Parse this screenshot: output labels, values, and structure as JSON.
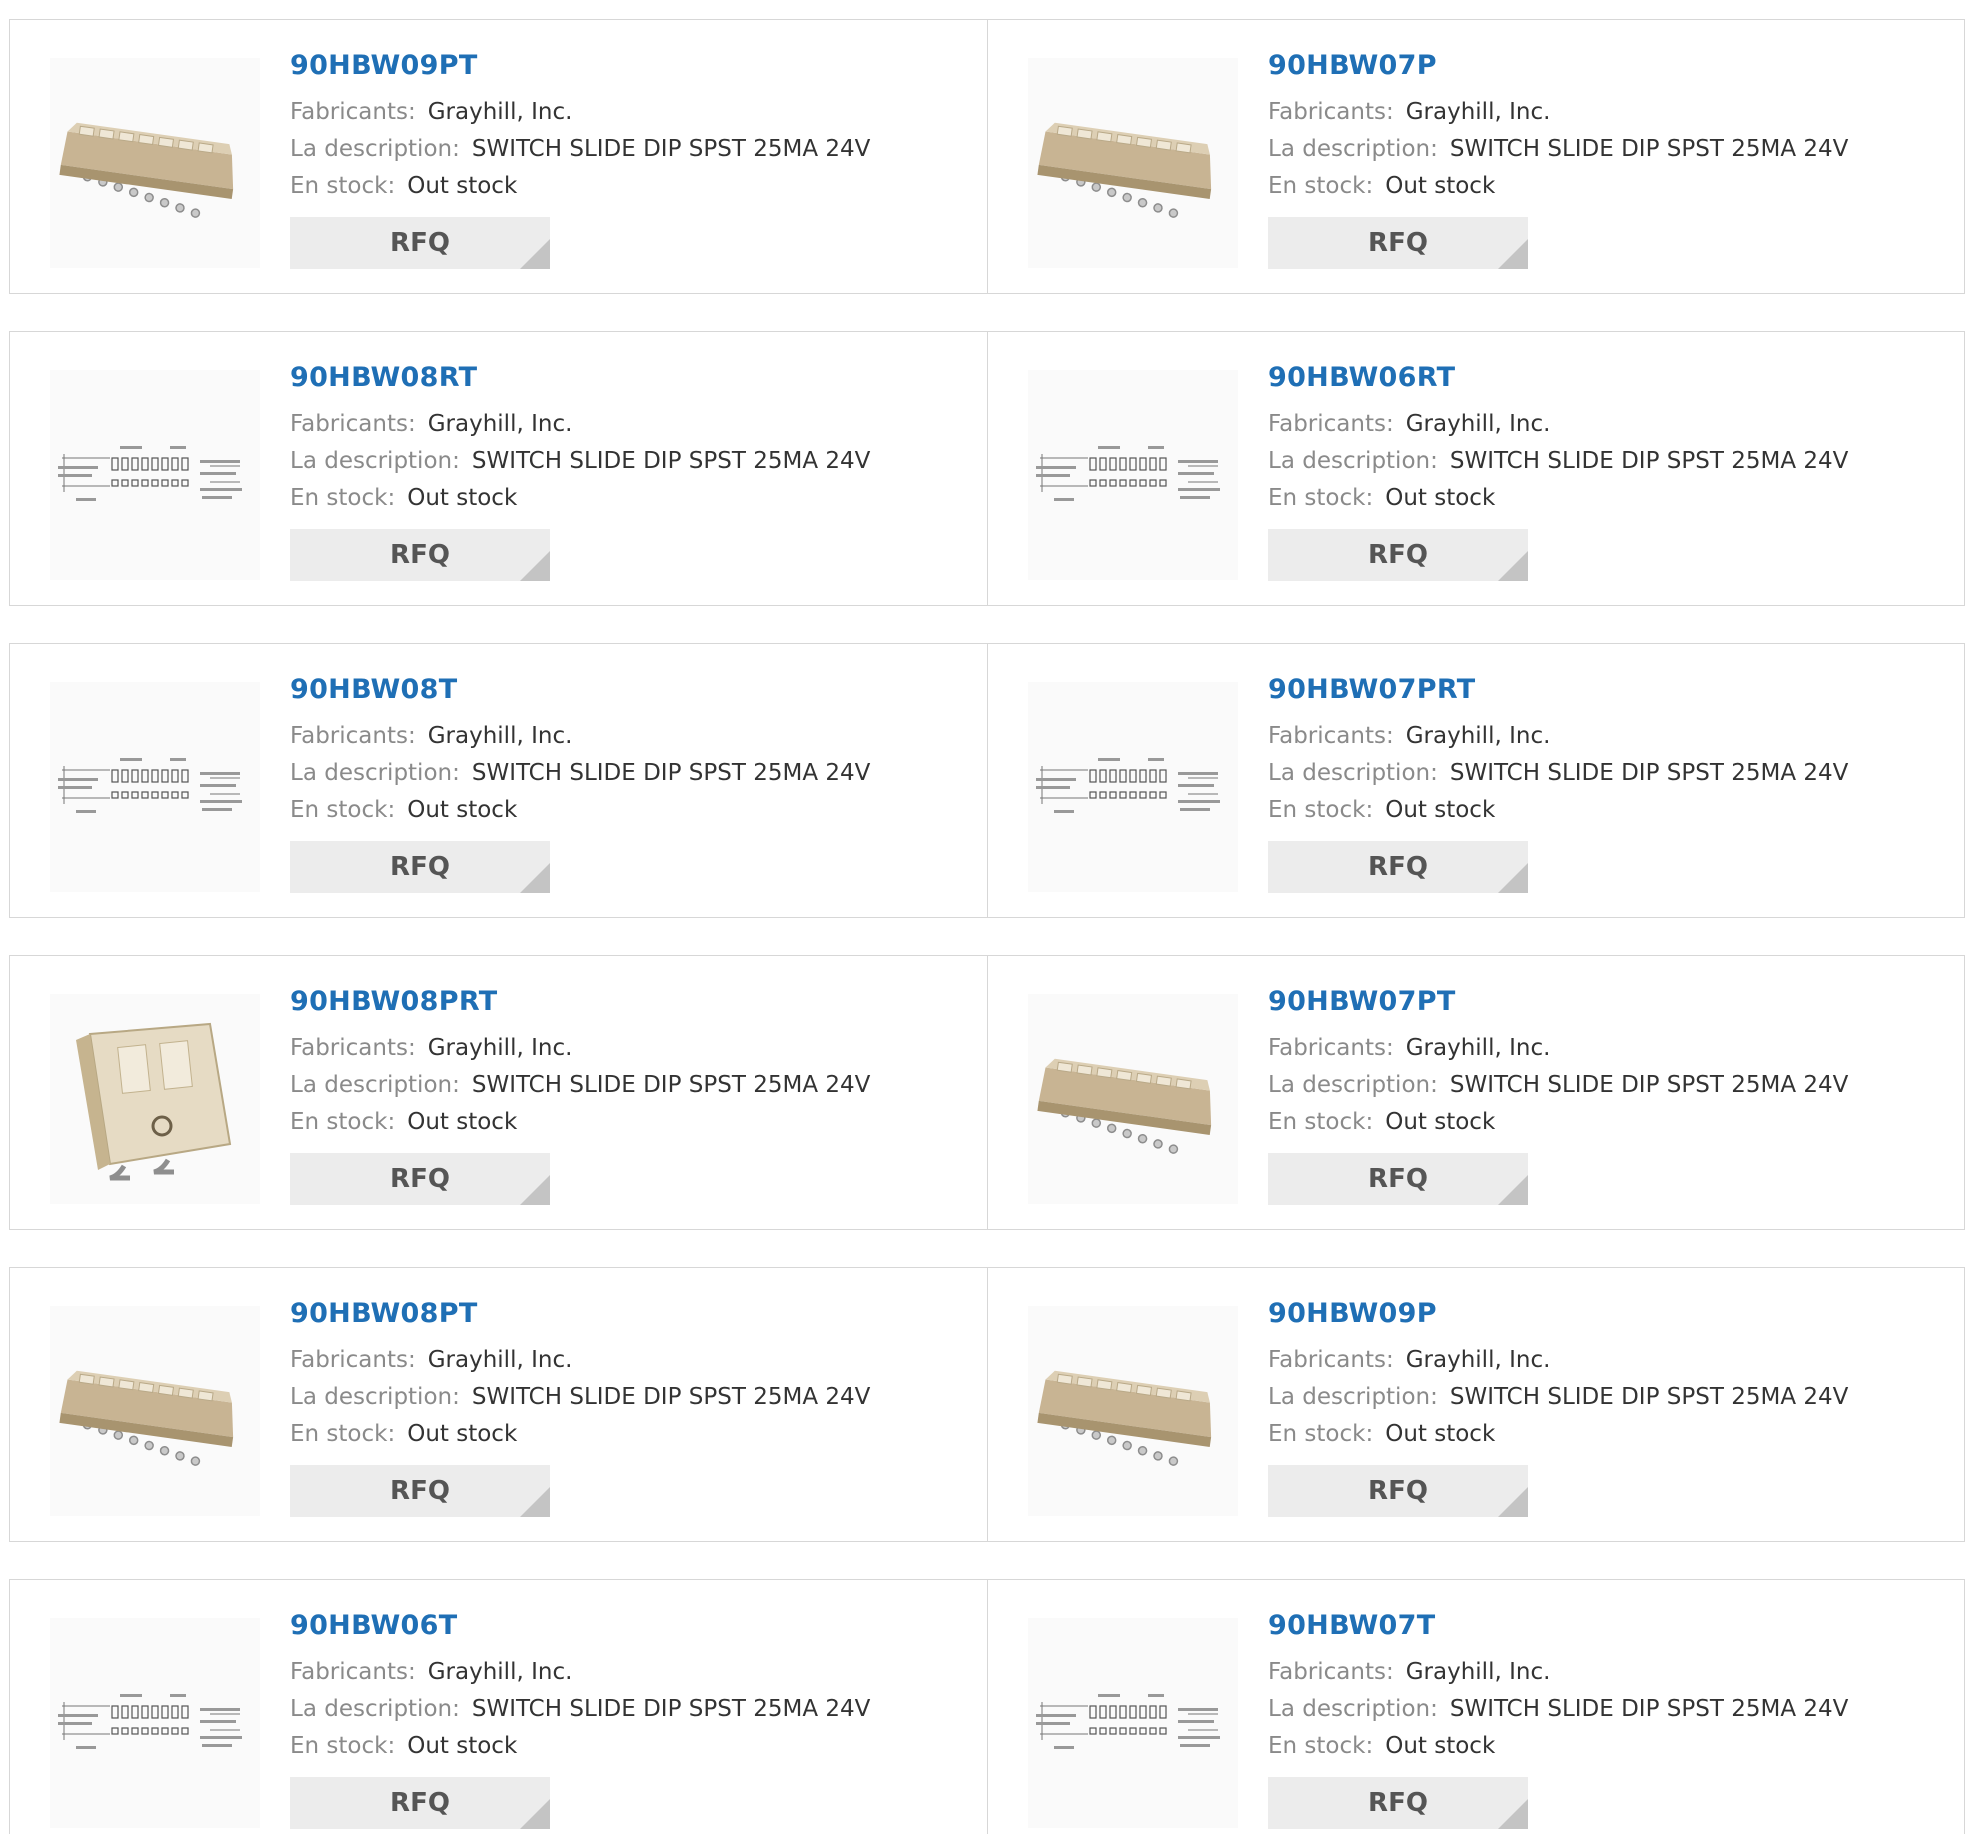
{
  "labels": {
    "manufacturer": "Fabricants:",
    "description": "La description:",
    "stock": "En stock:"
  },
  "button": {
    "rfq": "RFQ"
  },
  "rows": [
    [
      {
        "part": "90HBW09PT",
        "manufacturer": "Grayhill, Inc.",
        "description": "SWITCH SLIDE DIP SPST 25MA 24V",
        "stock": "Out stock",
        "image": "dip-switch-photo"
      },
      {
        "part": "90HBW07P",
        "manufacturer": "Grayhill, Inc.",
        "description": "SWITCH SLIDE DIP SPST 25MA 24V",
        "stock": "Out stock",
        "image": "dip-switch-photo"
      }
    ],
    [
      {
        "part": "90HBW08RT",
        "manufacturer": "Grayhill, Inc.",
        "description": "SWITCH SLIDE DIP SPST 25MA 24V",
        "stock": "Out stock",
        "image": "dimension-drawing"
      },
      {
        "part": "90HBW06RT",
        "manufacturer": "Grayhill, Inc.",
        "description": "SWITCH SLIDE DIP SPST 25MA 24V",
        "stock": "Out stock",
        "image": "dimension-drawing"
      }
    ],
    [
      {
        "part": "90HBW08T",
        "manufacturer": "Grayhill, Inc.",
        "description": "SWITCH SLIDE DIP SPST 25MA 24V",
        "stock": "Out stock",
        "image": "dimension-drawing"
      },
      {
        "part": "90HBW07PRT",
        "manufacturer": "Grayhill, Inc.",
        "description": "SWITCH SLIDE DIP SPST 25MA 24V",
        "stock": "Out stock",
        "image": "dimension-drawing"
      }
    ],
    [
      {
        "part": "90HBW08PRT",
        "manufacturer": "Grayhill, Inc.",
        "description": "SWITCH SLIDE DIP SPST 25MA 24V",
        "stock": "Out stock",
        "image": "dip-switch-2pos-photo"
      },
      {
        "part": "90HBW07PT",
        "manufacturer": "Grayhill, Inc.",
        "description": "SWITCH SLIDE DIP SPST 25MA 24V",
        "stock": "Out stock",
        "image": "dip-switch-photo"
      }
    ],
    [
      {
        "part": "90HBW08PT",
        "manufacturer": "Grayhill, Inc.",
        "description": "SWITCH SLIDE DIP SPST 25MA 24V",
        "stock": "Out stock",
        "image": "dip-switch-photo"
      },
      {
        "part": "90HBW09P",
        "manufacturer": "Grayhill, Inc.",
        "description": "SWITCH SLIDE DIP SPST 25MA 24V",
        "stock": "Out stock",
        "image": "dip-switch-photo"
      }
    ],
    [
      {
        "part": "90HBW06T",
        "manufacturer": "Grayhill, Inc.",
        "description": "SWITCH SLIDE DIP SPST 25MA 24V",
        "stock": "Out stock",
        "image": "dimension-drawing"
      },
      {
        "part": "90HBW07T",
        "manufacturer": "Grayhill, Inc.",
        "description": "SWITCH SLIDE DIP SPST 25MA 24V",
        "stock": "Out stock",
        "image": "dimension-drawing"
      }
    ]
  ]
}
